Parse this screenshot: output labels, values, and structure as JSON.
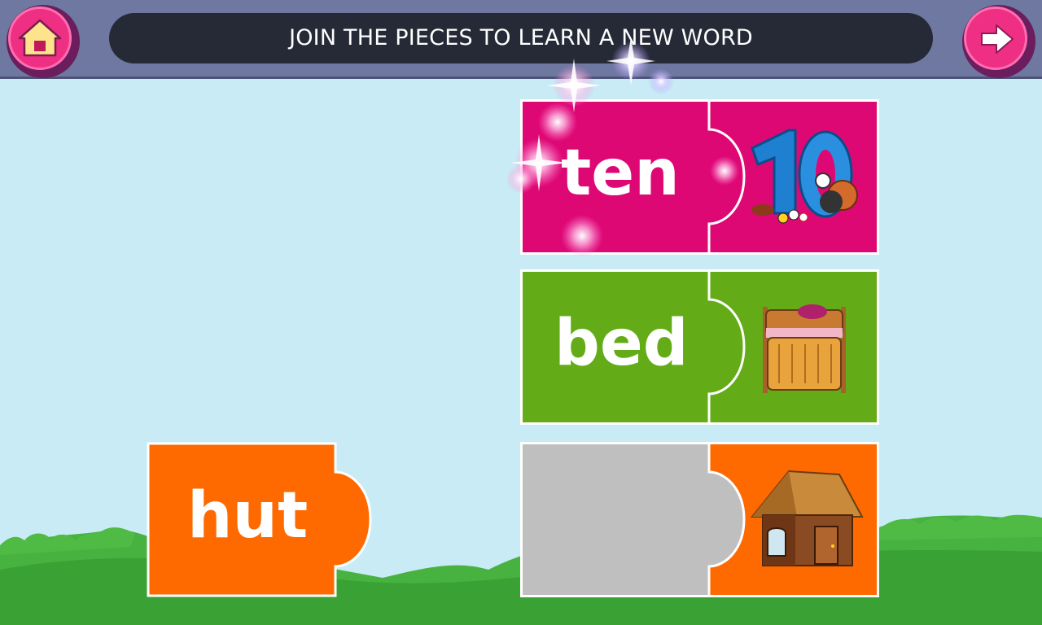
{
  "header": {
    "title": "JOIN THE PIECES TO LEARN A NEW WORD",
    "home_icon": "home-icon",
    "next_icon": "arrow-right-icon"
  },
  "colors": {
    "pink": "#de0875",
    "green": "#63ac18",
    "orange": "#ff6a00",
    "empty_slot": "#bfbfbf",
    "sky": "#c9ebf5",
    "grass": "#3fa93a",
    "topbar": "#6e78a0"
  },
  "puzzles": [
    {
      "word": "ten",
      "picture": "number-ten-with-sports-balls",
      "status": "completed"
    },
    {
      "word": "bed",
      "picture": "wooden-bed",
      "status": "completed"
    },
    {
      "word": "",
      "picture": "wooden-hut",
      "status": "empty-slot"
    }
  ],
  "draggable_piece": {
    "word": "hut"
  }
}
